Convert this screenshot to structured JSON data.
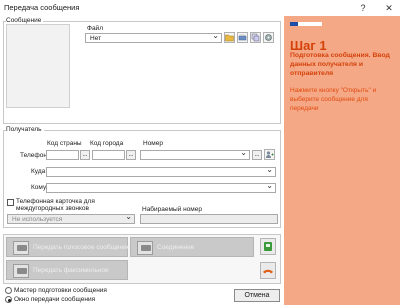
{
  "window": {
    "title": "Передача сообщения",
    "help_glyph": "?",
    "close_glyph": "✕"
  },
  "message": {
    "group_label": "Сообщение",
    "file_label": "Файл",
    "file_value": "Нет"
  },
  "recipient": {
    "group_label": "Получатель",
    "country_code_label": "Код страны",
    "city_code_label": "Код города",
    "number_label": "Номер",
    "phone_label": "Телефон",
    "where_label": "Куда",
    "whom_label": "Кому",
    "ellipsis": "...",
    "intercity_card_label": "Телефонная карточка для междугородных звонков",
    "dialed_number_label": "Набираемый номер",
    "card_value": "Не используется"
  },
  "actions": {
    "send_voice_label": "Передать голосовое сообщение",
    "connection_label": "Соединение",
    "send_fax_label": "Передать факсимильное"
  },
  "mode": {
    "wizard_label": "Мастер подготовки сообщения",
    "window_label": "Окно передачи сообщения",
    "selected": "window"
  },
  "cancel_label": "Отмена",
  "sidebar": {
    "progress": 0.25,
    "step_title": "Шаг 1",
    "step_subtitle": "Подготовка сообщения. Ввод данных получателя и отправителя",
    "step_text": "Нажмите кнопку \"Открыть\" и выберите сообщение для передачи"
  },
  "colors": {
    "sidebar_bg": "#f4a886",
    "accent_text": "#d4420a",
    "progress": "#1e4fa8"
  }
}
